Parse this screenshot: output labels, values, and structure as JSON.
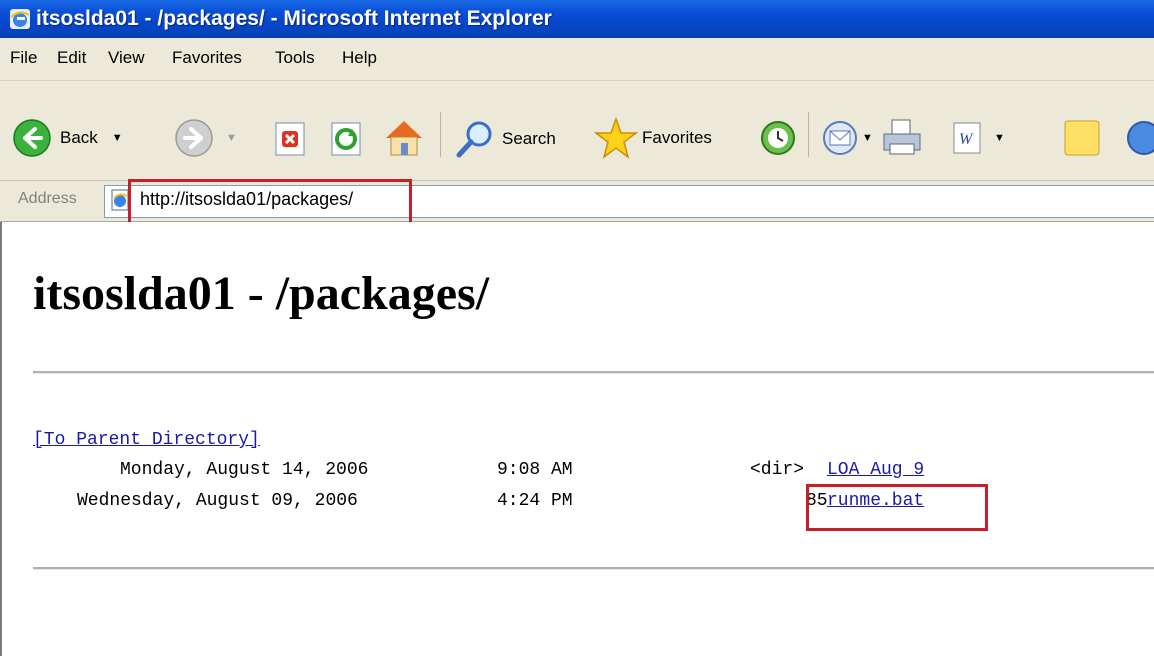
{
  "window": {
    "title": "itsoslda01 - /packages/ - Microsoft Internet Explorer"
  },
  "menu": [
    "File",
    "Edit",
    "View",
    "Favorites",
    "Tools",
    "Help"
  ],
  "toolbar": {
    "back_label": "Back",
    "search_label": "Search",
    "favorites_label": "Favorites"
  },
  "address": {
    "label": "Address",
    "url": "http://itsoslda01/packages/"
  },
  "page": {
    "heading": "itsoslda01 - /packages/",
    "parent_link": "[To Parent Directory]",
    "entries": [
      {
        "date": "Monday, August 14, 2006",
        "time": "9:08 AM",
        "size": "<dir>",
        "name": "LOA Aug 9"
      },
      {
        "date": "Wednesday, August 09, 2006",
        "time": "4:24 PM",
        "size": "85",
        "name": "runme.bat"
      }
    ]
  },
  "colors": {
    "highlight": "#c4202a",
    "link": "#1a1aa6",
    "titlebar": "#0a50d8"
  }
}
